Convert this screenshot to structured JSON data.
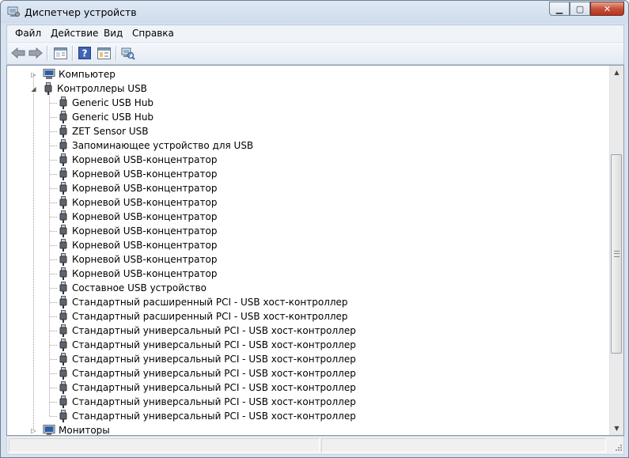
{
  "window": {
    "title": "Диспетчер устройств"
  },
  "menu": {
    "file": "Файл",
    "action": "Действие",
    "view": "Вид",
    "help": "Справка"
  },
  "toolbar": {
    "icons": [
      "back-arrow-icon",
      "forward-arrow-icon",
      "properties-icon",
      "help-icon",
      "view-icon",
      "scan-hardware-icon"
    ]
  },
  "tree": {
    "computer": "Компьютер",
    "usb_controllers": "Контроллеры USB",
    "devices": [
      "Generic USB Hub",
      "Generic USB Hub",
      "ZET Sensor USB",
      "Запоминающее устройство для USB",
      "Корневой USB-концентратор",
      "Корневой USB-концентратор",
      "Корневой USB-концентратор",
      "Корневой USB-концентратор",
      "Корневой USB-концентратор",
      "Корневой USB-концентратор",
      "Корневой USB-концентратор",
      "Корневой USB-концентратор",
      "Корневой USB-концентратор",
      "Составное USB устройство",
      "Стандартный расширенный PCI - USB хост-контроллер",
      "Стандартный расширенный PCI - USB хост-контроллер",
      "Стандартный универсальный PCI - USB хост-контроллер",
      "Стандартный универсальный PCI - USB хост-контроллер",
      "Стандартный универсальный PCI - USB хост-контроллер",
      "Стандартный универсальный PCI - USB хост-контроллер",
      "Стандартный универсальный PCI - USB хост-контроллер",
      "Стандартный универсальный PCI - USB хост-контроллер",
      "Стандартный универсальный PCI - USB хост-контроллер"
    ],
    "monitors": "Мониторы"
  }
}
